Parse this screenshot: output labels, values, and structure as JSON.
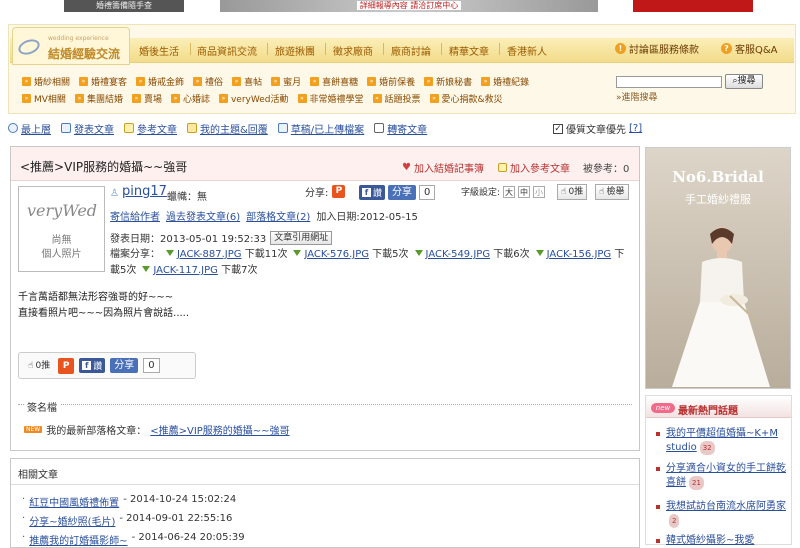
{
  "top_banner": {
    "left": "婚禮籌備隨手查",
    "middle": "詳細報導內容 請洽訂席中心"
  },
  "logo": {
    "en": "wedding experience",
    "zh": "結婚經驗交流"
  },
  "nav": {
    "items": [
      "婚後生活",
      "商品資訊交流",
      "旅遊揪團",
      "徵求廠商",
      "廠商討論",
      "精華文章",
      "香港新人"
    ],
    "policy": "討論區服務條款",
    "support": "客服Q&A"
  },
  "subnav": {
    "row1": [
      "婚紗相關",
      "婚禮宴客",
      "婚戒金飾",
      "禮俗",
      "喜帖",
      "蜜月",
      "喜餅喜糖",
      "婚前保養",
      "新娘秘書",
      "婚禮紀錄"
    ],
    "row2": [
      "MV相關",
      "集團結婚",
      "賣場",
      "心婚誌",
      "veryWed活動",
      "非常婚禮學堂",
      "話題投票",
      "愛心捐款&救災"
    ]
  },
  "search": {
    "button": "搜尋",
    "advanced": "»進階搜尋",
    "value": ""
  },
  "toolbar": {
    "items": [
      "最上層",
      "發表文章",
      "參考文章",
      "我的主題&回覆",
      "草稿/已上傳檔案",
      "轉寄文章"
    ],
    "quality": "優質文章優先",
    "help": "[?]"
  },
  "post": {
    "title": "<推薦>VIP服務的婚攝~~強哥",
    "wish": "加入結婚記事簿",
    "ref": "加入參考文章",
    "refcount": "被參考：0",
    "avatar": {
      "sig": "veryWed",
      "line1": "尚無",
      "line2": "個人照片"
    },
    "username": "ping17",
    "rank": "蠟幟：無",
    "share_label": "分享:",
    "fb_like": "讚",
    "fb_share": "分享",
    "share_count": "0",
    "fontset_label": "字級設定:",
    "font_sizes": [
      "大",
      "中",
      "小"
    ],
    "like": "0推",
    "report": "檢舉",
    "meta": {
      "sendmsg": "寄信給作者",
      "past": "過去發表文章(6)",
      "blog": "部落格文章(2)",
      "joined": "加入日期:2012-05-15",
      "posted": "發表日期：2013-05-01 19:52:33",
      "copy": "文章引用網址"
    },
    "attach_label": "檔案分享：",
    "attachments": [
      {
        "name": "JACK-887.JPG",
        "dl": "下載11次"
      },
      {
        "name": "JACK-576.JPG",
        "dl": "下載5次"
      },
      {
        "name": "JACK-549.JPG",
        "dl": "下載6次"
      },
      {
        "name": "JACK-156.JPG",
        "dl": "下載5次"
      },
      {
        "name": "JACK-117.JPG",
        "dl": "下載7次"
      }
    ],
    "body": [
      "千言萬語都無法形容強哥的好~~~",
      "直接看照片吧~~~因為照片會說話....."
    ],
    "bottom": {
      "like": "0推",
      "fb_like": "讚",
      "fb_share": "分享",
      "count": "0"
    },
    "sig_label": "簽名檔",
    "latest_label": "我的最新部落格文章：",
    "latest_link": "<推薦>VIP服務的婚攝~~強哥"
  },
  "related": {
    "title": "相關文章",
    "items": [
      {
        "title": "紅豆中國風婚禮佈置",
        "date": " - 2014-10-24 15:02:24"
      },
      {
        "title": "分享~婚紗照(毛片)",
        "date": " - 2014-09-01 22:55:16"
      },
      {
        "title": "推薦我的訂婚攝影師~",
        "date": " - 2014-06-24 20:05:39"
      }
    ]
  },
  "ad": {
    "title": "No6.Bridal",
    "sub": "手工婚紗禮服"
  },
  "hot": {
    "title": "最新熱門話題",
    "new": "new",
    "items": [
      {
        "title": "我的平價超值婚攝~K+M studio",
        "count": "32"
      },
      {
        "title": "分享適合小資女的手工餅乾喜餅",
        "count": "21"
      },
      {
        "title": "我想試訪台南流水席阿勇家",
        "count": "2"
      },
      {
        "title": "韓式婚紗攝影~我愛",
        "count": ""
      }
    ]
  },
  "colors": {
    "accent": "#f2a11f",
    "link": "#2a4f9c",
    "hot": "#b8312f"
  }
}
